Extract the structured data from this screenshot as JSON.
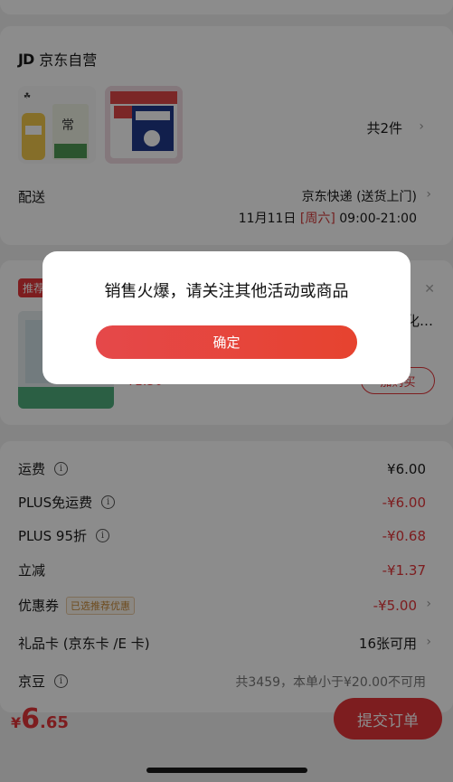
{
  "store": {
    "name": "京东自营",
    "logo_text": "JD",
    "item_count": "共2件"
  },
  "shipping": {
    "label": "配送",
    "method": "京东快递 (送货上门)",
    "date": "11月11日",
    "weekday": "[周六]",
    "time": "09:00-21:00"
  },
  "recommend": {
    "tag": "推荐",
    "title_fragment": "化…",
    "price": "¥1.50",
    "buy_button": "加购买"
  },
  "summary": {
    "rows": [
      {
        "label": "运费",
        "value": "¥6.00",
        "info": true
      },
      {
        "label": "PLUS免运费",
        "value": "-¥6.00",
        "info": true
      },
      {
        "label": "PLUS 95折",
        "value": "-¥0.68",
        "info": true
      },
      {
        "label": "立减",
        "value": "-¥1.37"
      },
      {
        "label": "优惠券",
        "badge": "已选推荐优惠",
        "value": "-¥5.00"
      },
      {
        "label": "礼品卡 (京东卡 /E 卡)",
        "value": "16张可用"
      },
      {
        "label": "京豆",
        "value": "共3459，本单小于¥20.00不可用",
        "info": true
      }
    ]
  },
  "footer": {
    "currency": "¥",
    "total_int": "6",
    "total_dec": ".65",
    "submit": "提交订单"
  },
  "dialog": {
    "message": "销售火爆，请关注其他活动或商品",
    "confirm": "确定"
  },
  "colors": {
    "accent": "#e3353a",
    "overlay": "rgba(0,0,0,0.45)"
  }
}
